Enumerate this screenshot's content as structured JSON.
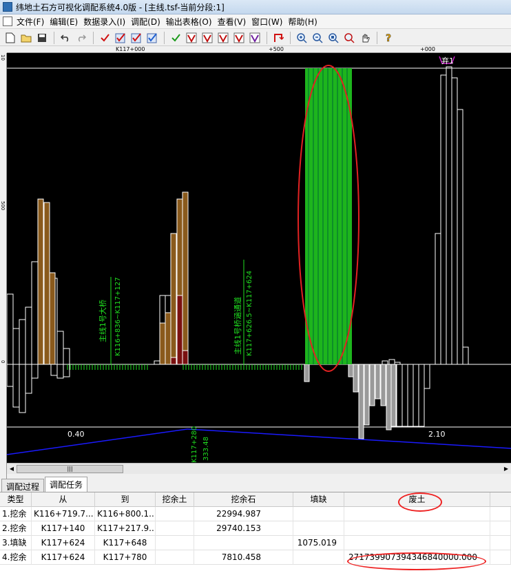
{
  "title": "纬地土石方可视化调配系统4.0版 - [主线.tsf-当前分段:1]",
  "menu": [
    "文件(F)",
    "编辑(E)",
    "数据录入(I)",
    "调配(D)",
    "输出表格(O)",
    "查看(V)",
    "窗口(W)",
    "帮助(H)"
  ],
  "toolbar_icons": [
    "new-icon",
    "open-icon",
    "save-icon",
    "undo-icon",
    "redo-icon",
    "check-red-icon",
    "check-box-icon",
    "check-box-icon",
    "check-box-icon",
    "check-green-icon",
    "check-v-icon",
    "check-v-icon",
    "check-v-icon",
    "check-v-icon",
    "check-v-icon",
    "return-icon",
    "zoom-in-icon",
    "zoom-out-icon",
    "zoom-fit-icon",
    "zoom-window-icon",
    "pan-icon",
    "help-icon"
  ],
  "ruler_top": [
    "K117+000",
    "+500",
    "+000"
  ],
  "ruler_left": [
    "10",
    "500",
    "0"
  ],
  "canvas": {
    "label_bridge": "主线1号大桥",
    "label_bridge_range": "K116+836~K117+127",
    "label_culvert": "主线1号桥涵通道",
    "label_culvert_range": "K117+626.5~K117+624",
    "marker": "弃1",
    "grade_left": "0.40",
    "grade_right": "2.10",
    "vpi_station": "K117+280",
    "vpi_elev": "333.48"
  },
  "tabs": [
    "调配过程",
    "调配任务"
  ],
  "grid": {
    "headers": [
      "类型",
      "从",
      "到",
      "挖余土",
      "挖余石",
      "填缺",
      "废土"
    ],
    "rows": [
      [
        "1.挖余",
        "K116+719.7...",
        "K116+800.1...",
        "",
        "22994.987",
        "",
        ""
      ],
      [
        "2.挖余",
        "K117+140",
        "K117+217.9...",
        "",
        "29740.153",
        "",
        ""
      ],
      [
        "3.填缺",
        "K117+624",
        "K117+648",
        "",
        "",
        "1075.019",
        ""
      ],
      [
        "4.挖余",
        "K117+624",
        "K117+780",
        "",
        "7810.458",
        "",
        "271739907394346840000.000"
      ]
    ]
  },
  "colors": {
    "excavation_soil": "#8a5a1c",
    "excavation_rock": "#7a1010",
    "disposal": "#1db51d",
    "fill": "#9a9a9a",
    "grade_line": "#1a1aff",
    "label": "#20e020",
    "annotation": "#e22222"
  }
}
